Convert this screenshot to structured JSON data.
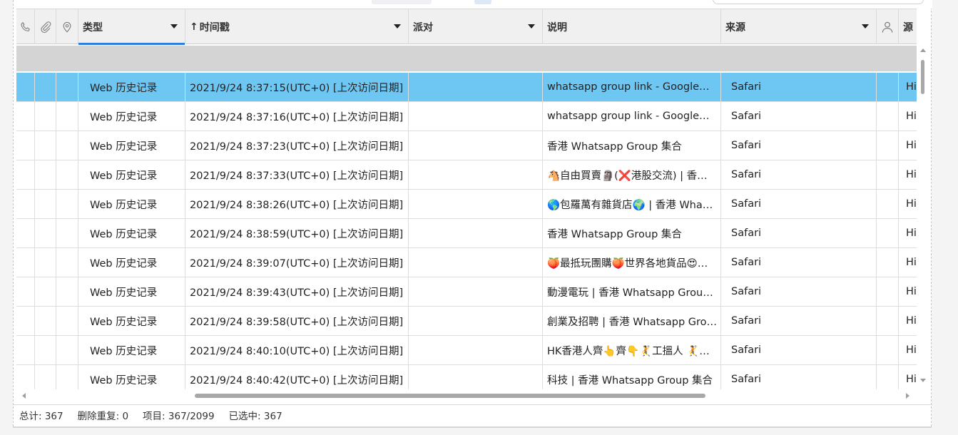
{
  "columns": {
    "type": "类型",
    "timestamp": "时间戳",
    "party": "派对",
    "description": "说明",
    "source": "来源",
    "source2": "源"
  },
  "rows": [
    {
      "type": "Web 历史记录",
      "timestamp": "2021/9/24 8:37:15(UTC+0) [上次访问日期]",
      "party": "",
      "description": "whatsapp group link - Google…",
      "source": "Safari",
      "source2": "Hi",
      "selected": true
    },
    {
      "type": "Web 历史记录",
      "timestamp": "2021/9/24 8:37:16(UTC+0) [上次访问日期]",
      "party": "",
      "description": "whatsapp group link - Google…",
      "source": "Safari",
      "source2": "Hi"
    },
    {
      "type": "Web 历史记录",
      "timestamp": "2021/9/24 8:37:23(UTC+0) [上次访问日期]",
      "party": "",
      "description": "香港 Whatsapp Group 集合",
      "source": "Safari",
      "source2": "Hi"
    },
    {
      "type": "Web 历史记录",
      "timestamp": "2021/9/24 8:37:33(UTC+0) [上次访问日期]",
      "party": "",
      "description": "🐴自由買賣🗿(❌港股交流) | 香…",
      "source": "Safari",
      "source2": "Hi"
    },
    {
      "type": "Web 历史记录",
      "timestamp": "2021/9/24 8:38:26(UTC+0) [上次访问日期]",
      "party": "",
      "description": "🌎包羅萬有雜貨店🌍 | 香港 Wha…",
      "source": "Safari",
      "source2": "Hi"
    },
    {
      "type": "Web 历史记录",
      "timestamp": "2021/9/24 8:38:59(UTC+0) [上次访问日期]",
      "party": "",
      "description": "香港 Whatsapp Group 集合",
      "source": "Safari",
      "source2": "Hi"
    },
    {
      "type": "Web 历史记录",
      "timestamp": "2021/9/24 8:39:07(UTC+0) [上次访问日期]",
      "party": "",
      "description": "🍑最抵玩團購🍑世界各地貨品😍…",
      "source": "Safari",
      "source2": "Hi"
    },
    {
      "type": "Web 历史记录",
      "timestamp": "2021/9/24 8:39:43(UTC+0) [上次访问日期]",
      "party": "",
      "description": "動漫電玩 | 香港 Whatsapp Grou…",
      "source": "Safari",
      "source2": "Hi"
    },
    {
      "type": "Web 历史记录",
      "timestamp": "2021/9/24 8:39:58(UTC+0) [上次访问日期]",
      "party": "",
      "description": "創業及招聘 | 香港 Whatsapp Gro…",
      "source": "Safari",
      "source2": "Hi"
    },
    {
      "type": "Web 历史记录",
      "timestamp": "2021/9/24 8:40:10(UTC+0) [上次访问日期]",
      "party": "",
      "description": "HK香港人齊👆齊👇🤾工搵人 🤾…",
      "source": "Safari",
      "source2": "Hi"
    },
    {
      "type": "Web 历史记录",
      "timestamp": "2021/9/24 8:40:42(UTC+0) [上次访问日期]",
      "party": "",
      "description": "科技 | 香港 Whatsapp Group 集合",
      "source": "Safari",
      "source2": "Hi"
    }
  ],
  "status": {
    "total": "总计: 367",
    "deleted": "删除重复: 0",
    "items": "项目: 367/2099",
    "selected": "已选中: 367"
  },
  "icons": {
    "phone": "phone-icon",
    "attachment": "paperclip-icon",
    "location": "location-pin-icon",
    "person": "person-icon"
  },
  "colors": {
    "selected_row": "#6ec6f2",
    "active_underline": "#2f7fd8",
    "header_bg": "#f0f0f0",
    "group_row": "#d4d4d4"
  }
}
